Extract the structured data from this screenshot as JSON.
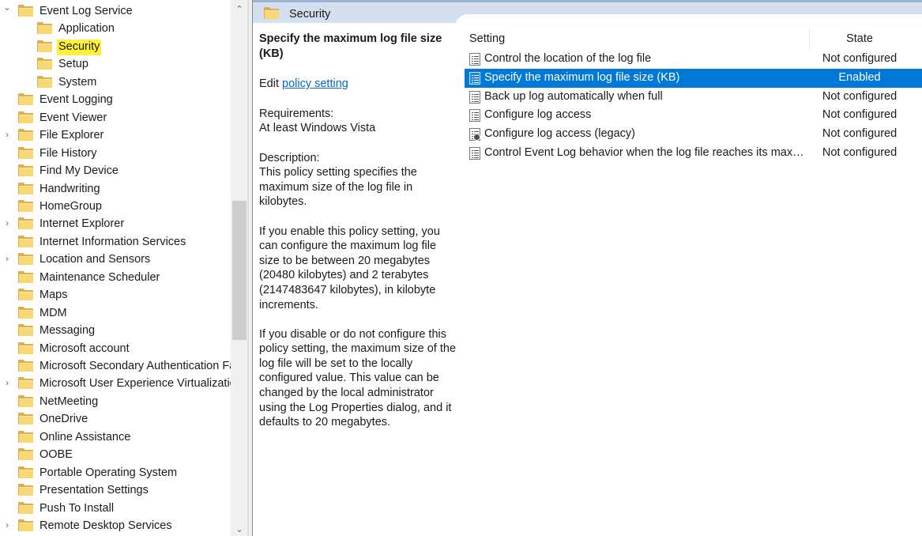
{
  "tree": {
    "items": [
      {
        "label": "Event Log Service",
        "expander": "chevron-down-icon",
        "indent": 0
      },
      {
        "label": "Application",
        "expander": "",
        "indent": 1
      },
      {
        "label": "Security",
        "expander": "",
        "indent": 1,
        "highlighted": true
      },
      {
        "label": "Setup",
        "expander": "",
        "indent": 1
      },
      {
        "label": "System",
        "expander": "",
        "indent": 1
      },
      {
        "label": "Event Logging",
        "expander": "",
        "indent": 0
      },
      {
        "label": "Event Viewer",
        "expander": "",
        "indent": 0
      },
      {
        "label": "File Explorer",
        "expander": "chevron-right-icon",
        "indent": 0
      },
      {
        "label": "File History",
        "expander": "",
        "indent": 0
      },
      {
        "label": "Find My Device",
        "expander": "",
        "indent": 0
      },
      {
        "label": "Handwriting",
        "expander": "",
        "indent": 0
      },
      {
        "label": "HomeGroup",
        "expander": "",
        "indent": 0
      },
      {
        "label": "Internet Explorer",
        "expander": "chevron-right-icon",
        "indent": 0
      },
      {
        "label": "Internet Information Services",
        "expander": "",
        "indent": 0
      },
      {
        "label": "Location and Sensors",
        "expander": "chevron-right-icon",
        "indent": 0
      },
      {
        "label": "Maintenance Scheduler",
        "expander": "",
        "indent": 0
      },
      {
        "label": "Maps",
        "expander": "",
        "indent": 0
      },
      {
        "label": "MDM",
        "expander": "",
        "indent": 0
      },
      {
        "label": "Messaging",
        "expander": "",
        "indent": 0
      },
      {
        "label": "Microsoft account",
        "expander": "",
        "indent": 0
      },
      {
        "label": "Microsoft Secondary Authentication Factor",
        "expander": "",
        "indent": 0
      },
      {
        "label": "Microsoft User Experience Virtualization",
        "expander": "chevron-right-icon",
        "indent": 0
      },
      {
        "label": "NetMeeting",
        "expander": "",
        "indent": 0
      },
      {
        "label": "OneDrive",
        "expander": "",
        "indent": 0
      },
      {
        "label": "Online Assistance",
        "expander": "",
        "indent": 0
      },
      {
        "label": "OOBE",
        "expander": "",
        "indent": 0
      },
      {
        "label": "Portable Operating System",
        "expander": "",
        "indent": 0
      },
      {
        "label": "Presentation Settings",
        "expander": "",
        "indent": 0
      },
      {
        "label": "Push To Install",
        "expander": "",
        "indent": 0
      },
      {
        "label": "Remote Desktop Services",
        "expander": "chevron-right-icon",
        "indent": 0
      }
    ]
  },
  "pane": {
    "title": "Security"
  },
  "description": {
    "title": "Specify the maximum log file size (KB)",
    "edit_prefix": "Edit ",
    "edit_link": "policy setting ",
    "requirements_label": "Requirements:",
    "requirements_value": "At least Windows Vista",
    "description_label": "Description:",
    "paragraph1": "This policy setting specifies the maximum size of the log file in kilobytes.",
    "paragraph2": "If you enable this policy setting, you can configure the maximum log file size to be between 20 megabytes (20480 kilobytes) and 2 terabytes (2147483647 kilobytes), in kilobyte increments.",
    "paragraph3": "If you disable or do not configure this policy setting, the maximum size of the log file will be set to the locally configured value. This value can be changed by the local administrator using the Log Properties dialog, and it defaults to 20 megabytes."
  },
  "list": {
    "col_setting": "Setting",
    "col_state": "State",
    "rows": [
      {
        "label": "Control the location of the log file",
        "state": "Not configured",
        "icon": "policy-icon"
      },
      {
        "label": "Specify the maximum log file size (KB)",
        "state": "Enabled",
        "icon": "policy-icon",
        "selected": true
      },
      {
        "label": "Back up log automatically when full",
        "state": "Not configured",
        "icon": "policy-icon"
      },
      {
        "label": "Configure log access",
        "state": "Not configured",
        "icon": "policy-icon"
      },
      {
        "label": "Configure log access (legacy)",
        "state": "Not configured",
        "icon": "legacy-policy-icon"
      },
      {
        "label": "Control Event Log behavior when the log file reaches its maximum size",
        "state": "Not configured",
        "icon": "policy-icon"
      }
    ]
  },
  "colors": {
    "selection": "#0078d7",
    "highlight": "#fff03a",
    "header_band": "#d3dfee",
    "link": "#0a64c8"
  }
}
